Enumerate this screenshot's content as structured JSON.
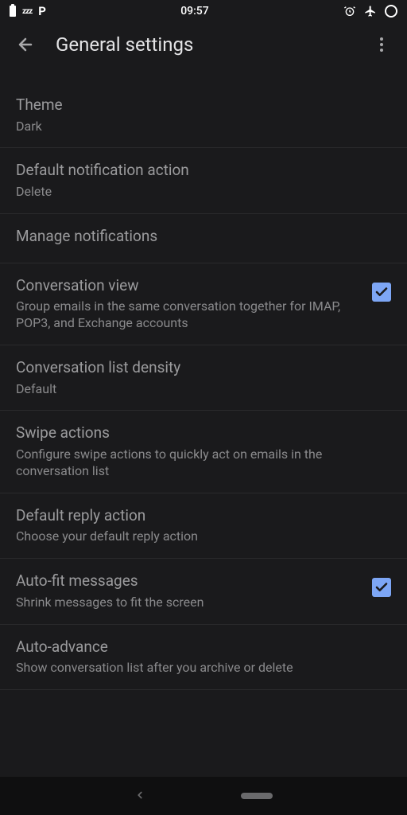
{
  "status": {
    "time": "09:57",
    "dnd": "zzz",
    "pIcon": "P"
  },
  "header": {
    "title": "General settings"
  },
  "settings": [
    {
      "title": "Theme",
      "subtitle": "Dark",
      "checkbox": false
    },
    {
      "title": "Default notification action",
      "subtitle": "Delete",
      "checkbox": false
    },
    {
      "title": "Manage notifications",
      "subtitle": "",
      "checkbox": false
    },
    {
      "title": "Conversation view",
      "subtitle": "Group emails in the same conversation together for IMAP, POP3, and Exchange accounts",
      "checkbox": true,
      "checked": true
    },
    {
      "title": "Conversation list density",
      "subtitle": "Default",
      "checkbox": false
    },
    {
      "title": "Swipe actions",
      "subtitle": "Configure swipe actions to quickly act on emails in the conversation list",
      "checkbox": false
    },
    {
      "title": "Default reply action",
      "subtitle": "Choose your default reply action",
      "checkbox": false
    },
    {
      "title": "Auto-fit messages",
      "subtitle": "Shrink messages to fit the screen",
      "checkbox": true,
      "checked": true
    },
    {
      "title": "Auto-advance",
      "subtitle": "Show conversation list after you archive or delete",
      "checkbox": false
    }
  ]
}
